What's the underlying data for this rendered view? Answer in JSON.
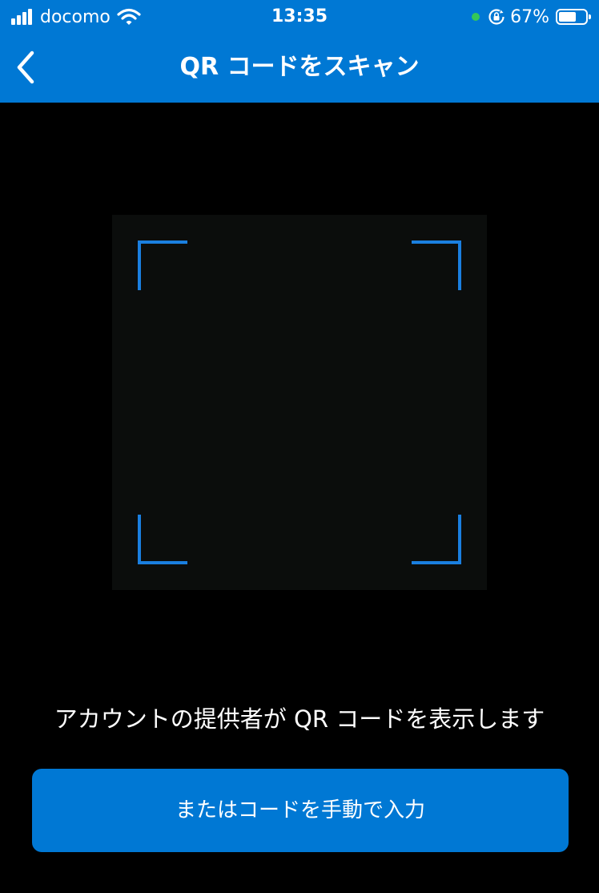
{
  "status_bar": {
    "carrier": "docomo",
    "time": "13:35",
    "battery_percent": "67%",
    "battery_level": 0.67,
    "icons": [
      "signal-icon",
      "wifi-icon",
      "green-dot-indicator",
      "rotation-lock-icon",
      "battery-icon"
    ]
  },
  "nav": {
    "title": "QR コードをスキャン",
    "back_icon": "chevron-left-icon"
  },
  "scanner": {
    "frame_color": "#1a7fe0"
  },
  "hint_text": "アカウントの提供者が QR コードを表示します",
  "manual_button_label": "またはコードを手動で入力",
  "colors": {
    "accent": "#0078d4",
    "background": "#000000"
  }
}
